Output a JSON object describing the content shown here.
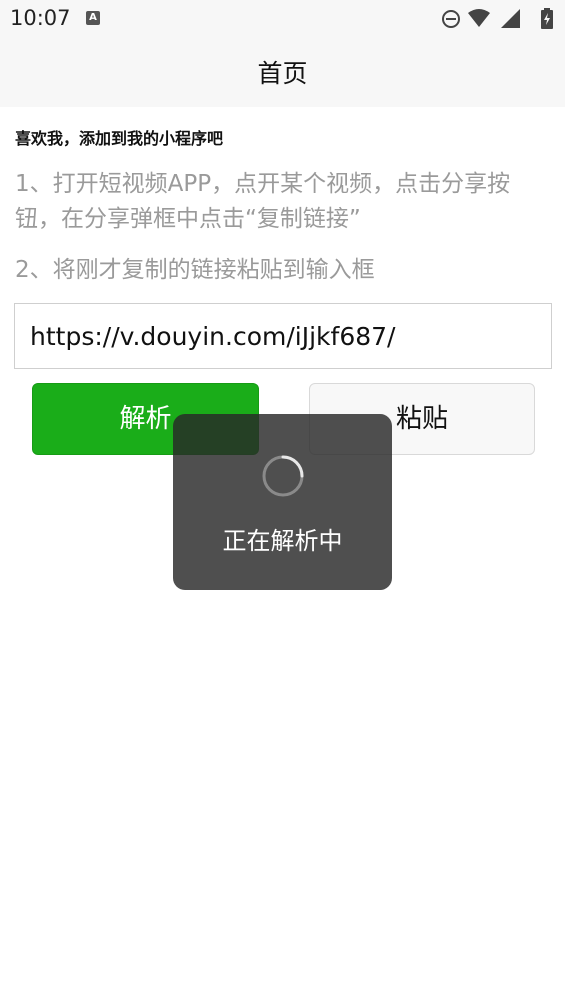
{
  "status_bar": {
    "time": "10:07",
    "icons": [
      "a-notification-icon",
      "do-not-disturb-icon",
      "wifi-icon",
      "cell-signal-icon",
      "battery-charging-icon"
    ]
  },
  "nav": {
    "title": "首页"
  },
  "content": {
    "headline": "喜欢我，添加到我的小程序吧",
    "step1": "1、打开短视频APP，点开某个视频，点击分享按钮，在分享弹框中点击“复制链接”",
    "step2": "2、将刚才复制的链接粘贴到输入框",
    "url_value": "https://v.douyin.com/iJjkf687/",
    "parse_label": "解析",
    "paste_label": "粘贴"
  },
  "toast": {
    "text": "正在解析中"
  },
  "colors": {
    "primary": "#1aad19",
    "toast_bg": "#282828",
    "hint_text": "#9a9a9a"
  }
}
